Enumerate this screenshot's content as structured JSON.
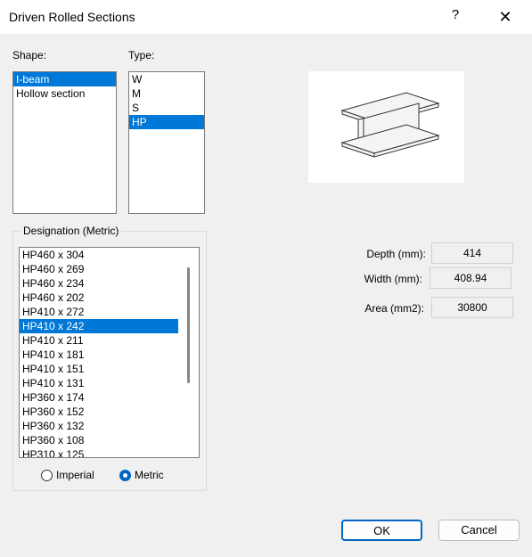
{
  "window": {
    "title": "Driven Rolled Sections",
    "help": "?",
    "close": "✕"
  },
  "shape": {
    "label": "Shape:",
    "items": [
      "I-beam",
      "Hollow section"
    ],
    "selected": 0
  },
  "type": {
    "label": "Type:",
    "items": [
      "W",
      "M",
      "S",
      "HP"
    ],
    "selected": 3
  },
  "designation": {
    "label": "Designation (Metric)",
    "items": [
      "HP460 x 304",
      "HP460 x 269",
      "HP460 x 234",
      "HP460 x 202",
      "HP410 x 272",
      "HP410 x 242",
      "HP410 x 211",
      "HP410 x 181",
      "HP410 x 151",
      "HP410 x 131",
      "HP360 x 174",
      "HP360 x 152",
      "HP360 x 132",
      "HP360 x 108",
      "HP310 x 125"
    ],
    "selected": 5
  },
  "units": {
    "imperial": "Imperial",
    "metric": "Metric",
    "selected": "metric"
  },
  "properties": {
    "depth_label": "Depth (mm):",
    "depth_value": "414",
    "width_label": "Width (mm):",
    "width_value": "408.94",
    "area_label": "Area (mm2):",
    "area_value": "30800"
  },
  "buttons": {
    "ok": "OK",
    "cancel": "Cancel"
  },
  "colors": {
    "selection": "#0078d7",
    "accent": "#0067c0"
  }
}
